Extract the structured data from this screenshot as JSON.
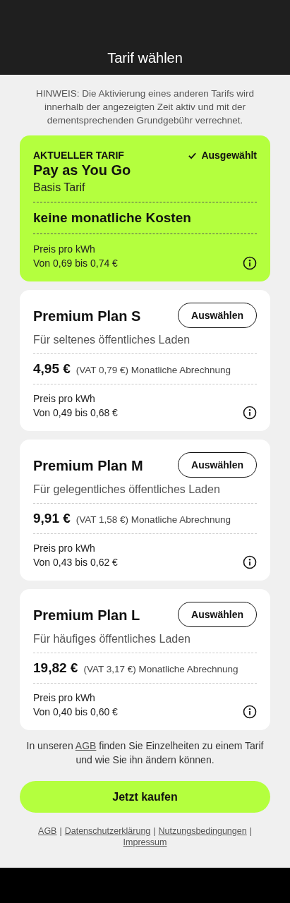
{
  "header": {
    "title": "Tarif wählen"
  },
  "hint": "HINWEIS: Die Aktivierung eines anderen Tarifs wird innerhalb der angezeigten Zeit aktiv und mit der dementsprechenden Grundgebühr verrechnet.",
  "plans": [
    {
      "selected": true,
      "tag": "AKTUELLER TARIF",
      "status": "Ausgewählt",
      "name": "Pay as You Go",
      "description": "Basis Tarif",
      "cost": "keine monatliche Kosten",
      "price_label": "Preis pro kWh",
      "price_range": "Von 0,69 bis 0,74 €"
    },
    {
      "selected": false,
      "button": "Auswählen",
      "name": "Premium Plan S",
      "description": "Für seltenes öffentliches Laden",
      "price": "4,95 €",
      "vat": "(VAT 0,79 €) Monatliche Abrechnung",
      "price_label": "Preis pro kWh",
      "price_range": "Von 0,49 bis 0,68 €"
    },
    {
      "selected": false,
      "button": "Auswählen",
      "name": "Premium Plan M",
      "description": "Für gelegentliches öffentliches Laden",
      "price": "9,91 €",
      "vat": "(VAT 1,58 €) Monatliche Abrechnung",
      "price_label": "Preis pro kWh",
      "price_range": "Von 0,43 bis 0,62 €"
    },
    {
      "selected": false,
      "button": "Auswählen",
      "name": "Premium Plan L",
      "description": "Für häufiges öffentliches Laden",
      "price": "19,82 €",
      "vat": "(VAT 3,17 €) Monatliche Abrechnung",
      "price_label": "Preis pro kWh",
      "price_range": "Von 0,40 bis 0,60 €"
    }
  ],
  "note": {
    "before": "In unseren",
    "link": "AGB",
    "after": "finden Sie Einzelheiten zu einem Tarif und wie Sie ihn ändern können."
  },
  "buy_button": "Jetzt kaufen",
  "footer_links": [
    {
      "label": "AGB",
      "separator": "|"
    },
    {
      "label": "Datenschutzerklärung",
      "separator": "|"
    },
    {
      "label": "Nutzungsbedingungen",
      "separator": "|"
    },
    {
      "label": "Impressum"
    }
  ]
}
